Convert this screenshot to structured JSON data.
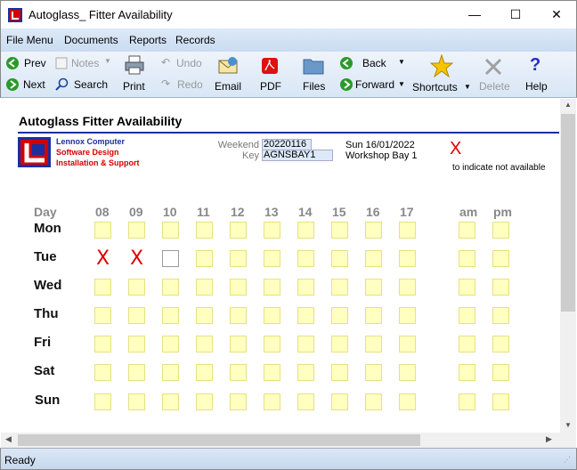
{
  "window": {
    "title": "Autoglass_ Fitter Availability",
    "minimize": "—",
    "maximize": "☐",
    "close": "✕"
  },
  "menu": [
    "File Menu",
    "Documents",
    "Reports",
    "Records"
  ],
  "toolbar": {
    "prev": "Prev",
    "next": "Next",
    "notes": "Notes",
    "search": "Search",
    "print": "Print",
    "undo": "Undo",
    "redo": "Redo",
    "email": "Email",
    "pdf": "PDF",
    "files": "Files",
    "back": "Back",
    "forward": "Forward",
    "shortcuts": "Shortcuts",
    "delete": "Delete",
    "help": "Help"
  },
  "form": {
    "heading": "Autoglass Fitter Availability",
    "company_line1": "Lennox Computer",
    "company_line2": "Software Design",
    "company_line3": "Installation & Support",
    "weekend_label": "Weekend",
    "weekend_value": "20220116",
    "key_label": "Key",
    "key_value": "AGNSBAY1",
    "date_text": "Sun 16/01/2022",
    "bay_text": "Workshop Bay 1",
    "legend_symbol": "X",
    "legend_text": "to indicate not available",
    "day_header": "Day",
    "hours": [
      "08",
      "09",
      "10",
      "11",
      "12",
      "13",
      "14",
      "15",
      "16",
      "17"
    ],
    "ampm": [
      "am",
      "pm"
    ],
    "days": [
      "Mon",
      "Tue",
      "Wed",
      "Thu",
      "Fri",
      "Sat",
      "Sun"
    ],
    "unavailable": [
      {
        "day": "Tue",
        "hour": "08"
      },
      {
        "day": "Tue",
        "hour": "09"
      }
    ],
    "focused_cell": {
      "day": "Tue",
      "hour": "10"
    }
  },
  "status": {
    "text": "Ready"
  },
  "colors": {
    "accent": "#1a2fa0",
    "cell_fill": "#ffffc0",
    "x_color": "#e00000",
    "brand_red": "#d40000",
    "brand_blue": "#1a2fa0"
  }
}
